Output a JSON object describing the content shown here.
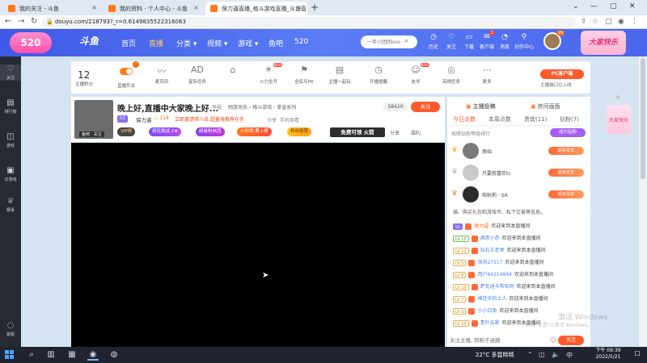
{
  "browser": {
    "tabs": [
      {
        "title": "我的关注 - 斗鱼",
        "close": "×"
      },
      {
        "title": "我的资料 - 个人中心 - 斗鱼",
        "close": "×"
      },
      {
        "title": "保力逼直播_格斗游戏直播_斗鱼直",
        "close": "×"
      }
    ],
    "new_tab": "+",
    "window_controls": [
      "⌄",
      "—",
      "▢",
      "✕"
    ],
    "url": "douyu.com/218793?_r=0.6149835522316063",
    "nav": {
      "back": "←",
      "forward": "→",
      "reload": "↻"
    }
  },
  "site": {
    "promo_left": "520",
    "logo": "斗鱼",
    "nav": [
      "首页",
      "直播",
      "分类 ▾",
      "视频 ▾",
      "游戏 ▾",
      "鱼吧",
      "520"
    ],
    "search_placeholder": "一条小团团ovo",
    "header_items": [
      {
        "icon": "◷",
        "label": "历史"
      },
      {
        "icon": "♡",
        "label": "关注"
      },
      {
        "icon": "▭",
        "label": "下载"
      },
      {
        "icon": "✉",
        "label": "客户端",
        "badge": "2"
      },
      {
        "icon": "◔",
        "label": "消息"
      },
      {
        "icon": "⚲",
        "label": "创作中心"
      }
    ],
    "avatar_level": "29",
    "promo_right": "大家快乐"
  },
  "sidebar": [
    {
      "icon": "♡",
      "label": "关注"
    },
    {
      "icon": "▤",
      "label": "排行榜"
    },
    {
      "icon": "◫",
      "label": "游戏"
    },
    {
      "icon": "▣",
      "label": "云游戏"
    },
    {
      "icon": "♕",
      "label": "赛事"
    },
    {
      "icon": "◌",
      "label": "客服"
    }
  ],
  "toolbar": {
    "count": "12",
    "count_label": "主播积分",
    "dot": "!",
    "tools": [
      {
        "label": "直播开关",
        "icon": ""
      },
      {
        "label": "麦克风",
        "icon": "〰"
      },
      {
        "label": "星际任务",
        "icon": "AD"
      },
      {
        "label": "",
        "icon": "⌂"
      },
      {
        "label": "火力全开",
        "icon": "☀",
        "new": "NEW"
      },
      {
        "label": "全民乐PK",
        "icon": "⚑"
      },
      {
        "label": "主播一起玩",
        "icon": "▤"
      },
      {
        "label": "开播提醒",
        "icon": "◷"
      },
      {
        "label": "友邻",
        "icon": "☺",
        "new": "NEW"
      },
      {
        "label": "亮相任务",
        "icon": "◎"
      },
      {
        "label": "更多",
        "icon": "⋯"
      }
    ],
    "pc_client": "PC客户端",
    "pc_status": "主播端口已上线"
  },
  "room": {
    "avatar_tag": "鱼吧 · 关注",
    "title": "晚上好,直播中大家晚上好...",
    "report": "举报",
    "breadcrumb": "网游竞技 › 格斗游戏 › 拳皇系列",
    "followers": "58420",
    "follow_label": "关注",
    "level": "S1",
    "anchor": "保力逼",
    "hot": "♨ 114",
    "ad": "立即邀请得八倍,超量强推荐在手",
    "link_share_room": "分享",
    "link_mobile": "手机观看",
    "vip": "VIP榜",
    "chips": [
      "疯狂挑战 2★",
      "超级粉丝团",
      "小时榜·第上榜",
      "粉丝勋章"
    ],
    "free_gift": "免费可领 火箭",
    "share": "分享",
    "welfare": "福利",
    "cursor": "➤"
  },
  "right_panel": {
    "tab_rank": "主播投稿",
    "tab_gift": "房间画面",
    "subtabs": [
      "今日点数",
      "本周点数",
      "贵宾(11)",
      "钻粉(7)"
    ],
    "rank_caption": "按照钻粉等级排行",
    "rank_btn": "成为钻粉",
    "rank_rows": [
      {
        "crown": "♛",
        "name": "原始",
        "badge": "超级贵宾"
      },
      {
        "crown": "♛",
        "name": "只要我喜欢tc",
        "badge": "超级贵宾"
      },
      {
        "crown": "♛",
        "name": "帕秋莉 · SA",
        "badge": "超级贵宾"
      }
    ],
    "notice": "描、购买礼包和游戏币、私下交易等信息。",
    "chats": [
      {
        "lv": "S1",
        "lv_class": "lv-purple",
        "user": "保力逼",
        "user_class": "orange",
        "msg": "欢迎来到本直播间"
      },
      {
        "lv": "LV 15",
        "lv_class": "lv-green",
        "user": "满意小赤",
        "user_class": "",
        "msg": "欢迎来到本直播间"
      },
      {
        "lv": "LV 12",
        "lv_class": "",
        "user": "钻石王老师",
        "user_class": "",
        "msg": "欢迎来到本直播间"
      },
      {
        "lv": "LV 5",
        "lv_class": "",
        "user": "深圳27517",
        "user_class": "",
        "msg": "欢迎来到本直播间"
      },
      {
        "lv": "LV 8",
        "lv_class": "",
        "user": "用户64214994",
        "user_class": "",
        "msg": "欢迎来到本直播间"
      },
      {
        "lv": "LV 19",
        "lv_class": "",
        "user": "萨瓦迪卡布布呀",
        "user_class": "",
        "msg": "欢迎来到本直播间"
      },
      {
        "lv": "LV 7",
        "lv_class": "",
        "user": "棉连中的土人",
        "user_class": "",
        "msg": "欢迎来到本直播间"
      },
      {
        "lv": "LV 3",
        "lv_class": "",
        "user": "小小白兔",
        "user_class": "",
        "msg": "欢迎来到本直播间"
      },
      {
        "lv": "LV 10",
        "lv_class": "",
        "user": "青叶云家",
        "user_class": "",
        "msg": "欢迎来到本直播间"
      }
    ],
    "input_placeholder": "关注主播, 转粉不迷路",
    "emoji": "☺",
    "send": "关注",
    "watermark": "激活 Windows",
    "watermark_sub": "转到\"设置\"以激活 Windows。",
    "float_promo": "大家快乐",
    "float_plus": "+"
  },
  "taskbar": {
    "apps": [
      "⌕",
      "▥",
      "▦",
      "◉",
      "◍"
    ],
    "weather": "22°C 多雲時晴",
    "tray": [
      "⌃",
      "◫",
      "🔈",
      "中"
    ],
    "time": "下午 09:39",
    "date": "2022/5/21",
    "notif": "☐"
  },
  "colors": {
    "accent": "#ff5a2c",
    "header": "#4a66ec",
    "taskbar": "#1f2430"
  }
}
